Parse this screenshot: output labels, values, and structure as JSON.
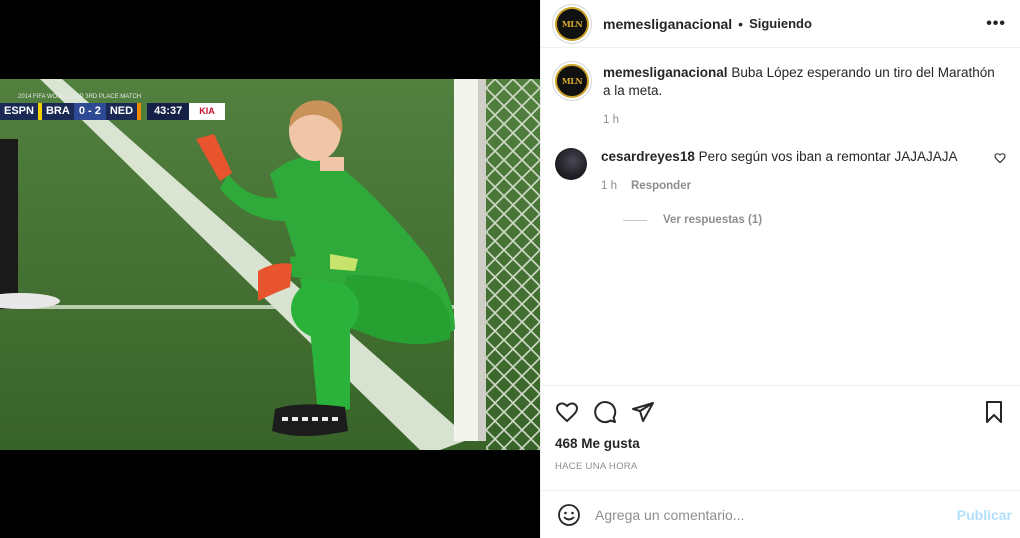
{
  "post": {
    "username": "memesliganacional",
    "follow_status": "Siguiendo",
    "separator": "•",
    "more_label": "•••",
    "avatar_text": "MLN"
  },
  "media": {
    "scoreboard": {
      "top_text": "2014 FIFA WORLD CUP 3RD PLACE MATCH",
      "channel": "ESPN",
      "team1": "BRA",
      "score": "0 - 2",
      "team2": "NED",
      "clock": "43:37",
      "sponsor": "KIA"
    }
  },
  "caption": {
    "username": "memesliganacional",
    "text": "Buba López esperando un tiro del Marathón a la meta.",
    "time": "1 h"
  },
  "comments": [
    {
      "username": "cesardreyes18",
      "text": "Pero según vos iban a remontar JAJAJAJA",
      "time": "1 h",
      "reply_label": "Responder",
      "view_replies": "Ver respuestas (1)"
    }
  ],
  "stats": {
    "likes": "468 Me gusta",
    "timestamp": "HACE UNA HORA"
  },
  "composer": {
    "placeholder": "Agrega un comentario...",
    "publish_label": "Publicar"
  },
  "colors": {
    "pitch": "#3f6d31",
    "kit": "#2faa3a",
    "link_disabled": "#b2dffc",
    "muted_text": "#8e8e8e"
  }
}
